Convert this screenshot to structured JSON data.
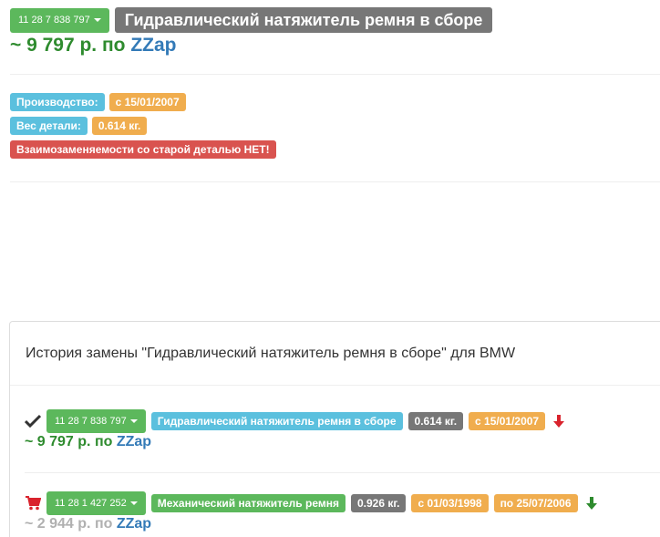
{
  "product": {
    "part_number": "11 28 7 838 797",
    "title": "Гидравлический натяжитель ремня в сборе",
    "price_prefix": "~ 9 797 р. по",
    "price_source": "ZZap"
  },
  "attributes": {
    "production_label": "Производство:",
    "production_value": "с 15/01/2007",
    "weight_label": "Вес детали:",
    "weight_value": "0.614 кг.",
    "warning": "Взаимозаменяемости со старой деталью НЕТ!"
  },
  "history": {
    "title": "История замены \"Гидравлический натяжитель ремня в сборе\" для BMW",
    "items": [
      {
        "status_icon": "checkmark-icon",
        "part_number": "11 28 7 838 797",
        "name": "Гидравлический натяжитель ремня в сборе",
        "weight": "0.614 кг.",
        "from_date": "с 15/01/2007",
        "direction_icon": "arrow-down-red-icon",
        "price_prefix": "~ 9 797 р. по",
        "price_source": "ZZap"
      },
      {
        "status_icon": "cart-icon",
        "part_number": "11 28 1 427 252",
        "name": "Механический натяжитель ремня",
        "weight": "0.926 кг.",
        "from_date": "с 01/03/1998",
        "to_date": "по 25/07/2006",
        "direction_icon": "arrow-down-green-icon",
        "price_prefix": "~ 2 944 р. по",
        "price_source": "ZZap"
      }
    ]
  },
  "colors": {
    "green": "#5cb85c",
    "info": "#5bc0de",
    "warning": "#f0ad4e",
    "danger": "#d9534f",
    "default": "#777777",
    "link": "#337ab7"
  }
}
